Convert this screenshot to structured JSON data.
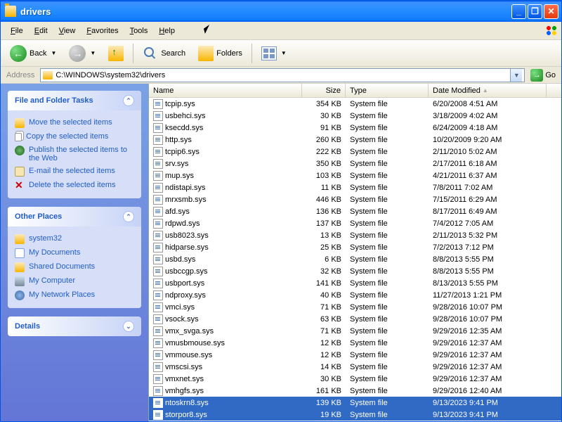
{
  "window": {
    "title": "drivers"
  },
  "menu": {
    "items": [
      "File",
      "Edit",
      "View",
      "Favorites",
      "Tools",
      "Help"
    ]
  },
  "toolbar": {
    "back": "Back",
    "search": "Search",
    "folders": "Folders"
  },
  "address": {
    "label": "Address",
    "path": "C:\\WINDOWS\\system32\\drivers",
    "go": "Go"
  },
  "sidebar": {
    "tasks": {
      "title": "File and Folder Tasks",
      "items": [
        "Move the selected items",
        "Copy the selected items",
        "Publish the selected items to the Web",
        "E-mail the selected items",
        "Delete the selected items"
      ]
    },
    "places": {
      "title": "Other Places",
      "items": [
        "system32",
        "My Documents",
        "Shared Documents",
        "My Computer",
        "My Network Places"
      ]
    },
    "details": {
      "title": "Details"
    }
  },
  "columns": {
    "name": "Name",
    "size": "Size",
    "type": "Type",
    "date": "Date Modified"
  },
  "files": [
    {
      "name": "tcpip.sys",
      "size": "354 KB",
      "type": "System file",
      "date": "6/20/2008 4:51 AM",
      "sel": false
    },
    {
      "name": "usbehci.sys",
      "size": "30 KB",
      "type": "System file",
      "date": "3/18/2009 4:02 AM",
      "sel": false
    },
    {
      "name": "ksecdd.sys",
      "size": "91 KB",
      "type": "System file",
      "date": "6/24/2009 4:18 AM",
      "sel": false
    },
    {
      "name": "http.sys",
      "size": "260 KB",
      "type": "System file",
      "date": "10/20/2009 9:20 AM",
      "sel": false
    },
    {
      "name": "tcpip6.sys",
      "size": "222 KB",
      "type": "System file",
      "date": "2/11/2010 5:02 AM",
      "sel": false
    },
    {
      "name": "srv.sys",
      "size": "350 KB",
      "type": "System file",
      "date": "2/17/2011 6:18 AM",
      "sel": false
    },
    {
      "name": "mup.sys",
      "size": "103 KB",
      "type": "System file",
      "date": "4/21/2011 6:37 AM",
      "sel": false
    },
    {
      "name": "ndistapi.sys",
      "size": "11 KB",
      "type": "System file",
      "date": "7/8/2011 7:02 AM",
      "sel": false
    },
    {
      "name": "mrxsmb.sys",
      "size": "446 KB",
      "type": "System file",
      "date": "7/15/2011 6:29 AM",
      "sel": false
    },
    {
      "name": "afd.sys",
      "size": "136 KB",
      "type": "System file",
      "date": "8/17/2011 6:49 AM",
      "sel": false
    },
    {
      "name": "rdpwd.sys",
      "size": "137 KB",
      "type": "System file",
      "date": "7/4/2012 7:05 AM",
      "sel": false
    },
    {
      "name": "usb8023.sys",
      "size": "13 KB",
      "type": "System file",
      "date": "2/11/2013 5:32 PM",
      "sel": false
    },
    {
      "name": "hidparse.sys",
      "size": "25 KB",
      "type": "System file",
      "date": "7/2/2013 7:12 PM",
      "sel": false
    },
    {
      "name": "usbd.sys",
      "size": "6 KB",
      "type": "System file",
      "date": "8/8/2013 5:55 PM",
      "sel": false
    },
    {
      "name": "usbccgp.sys",
      "size": "32 KB",
      "type": "System file",
      "date": "8/8/2013 5:55 PM",
      "sel": false
    },
    {
      "name": "usbport.sys",
      "size": "141 KB",
      "type": "System file",
      "date": "8/13/2013 5:55 PM",
      "sel": false
    },
    {
      "name": "ndproxy.sys",
      "size": "40 KB",
      "type": "System file",
      "date": "11/27/2013 1:21 PM",
      "sel": false
    },
    {
      "name": "vmci.sys",
      "size": "71 KB",
      "type": "System file",
      "date": "9/28/2016 10:07 PM",
      "sel": false
    },
    {
      "name": "vsock.sys",
      "size": "63 KB",
      "type": "System file",
      "date": "9/28/2016 10:07 PM",
      "sel": false
    },
    {
      "name": "vmx_svga.sys",
      "size": "71 KB",
      "type": "System file",
      "date": "9/29/2016 12:35 AM",
      "sel": false
    },
    {
      "name": "vmusbmouse.sys",
      "size": "12 KB",
      "type": "System file",
      "date": "9/29/2016 12:37 AM",
      "sel": false
    },
    {
      "name": "vmmouse.sys",
      "size": "12 KB",
      "type": "System file",
      "date": "9/29/2016 12:37 AM",
      "sel": false
    },
    {
      "name": "vmscsi.sys",
      "size": "14 KB",
      "type": "System file",
      "date": "9/29/2016 12:37 AM",
      "sel": false
    },
    {
      "name": "vmxnet.sys",
      "size": "30 KB",
      "type": "System file",
      "date": "9/29/2016 12:37 AM",
      "sel": false
    },
    {
      "name": "vmhgfs.sys",
      "size": "161 KB",
      "type": "System file",
      "date": "9/29/2016 12:40 AM",
      "sel": false
    },
    {
      "name": "ntoskrn8.sys",
      "size": "139 KB",
      "type": "System file",
      "date": "9/13/2023 9:41 PM",
      "sel": true
    },
    {
      "name": "storpor8.sys",
      "size": "19 KB",
      "type": "System file",
      "date": "9/13/2023 9:41 PM",
      "sel": true
    }
  ]
}
